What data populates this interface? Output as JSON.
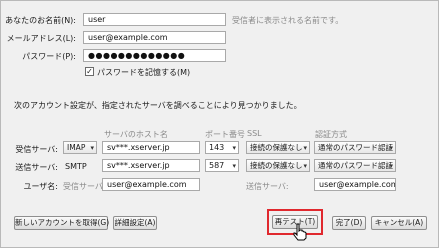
{
  "account": {
    "name_label": "あなたのお名前(N):",
    "name_value": "user",
    "name_hint": "受信者に表示される名前です。",
    "email_label": "メールアドレス(L):",
    "email_value": "user@example.com",
    "password_label": "パスワード(P):",
    "password_value": "●●●●●●●●●●●●●",
    "remember_label": "パスワードを記憶する(M)",
    "remember_checked": "✓"
  },
  "message": "次のアカウント設定が、指定されたサーバを調べることにより見つかりました。",
  "server_table": {
    "headers": {
      "host": "サーバのホスト名",
      "port": "ポート番号",
      "ssl": "SSL",
      "auth": "認証方式"
    },
    "incoming": {
      "label": "受信サーバ:",
      "protocol": "IMAP",
      "host": "sv***.xserver.jp",
      "port": "143",
      "ssl": "接続の保護なし",
      "auth": "通常のパスワード認証"
    },
    "outgoing": {
      "label": "送信サーバ:",
      "protocol": "SMTP",
      "host": "sv***.xserver.jp",
      "port": "587",
      "ssl": "接続の保護なし",
      "auth": "通常のパスワード認証"
    },
    "username": {
      "label": "ユーザ名:",
      "incoming_label": "受信サーバ:",
      "incoming_value": "user@example.com",
      "outgoing_label": "送信サーバ:",
      "outgoing_value": "user@example.com"
    }
  },
  "buttons": {
    "new_account": "新しいアカウントを取得(G)",
    "advanced": "詳細設定(A)",
    "retest": "再テスト(T)",
    "done": "完了(D)",
    "cancel": "キャンセル(A)"
  },
  "colors": {
    "highlight": "#e0282e"
  }
}
